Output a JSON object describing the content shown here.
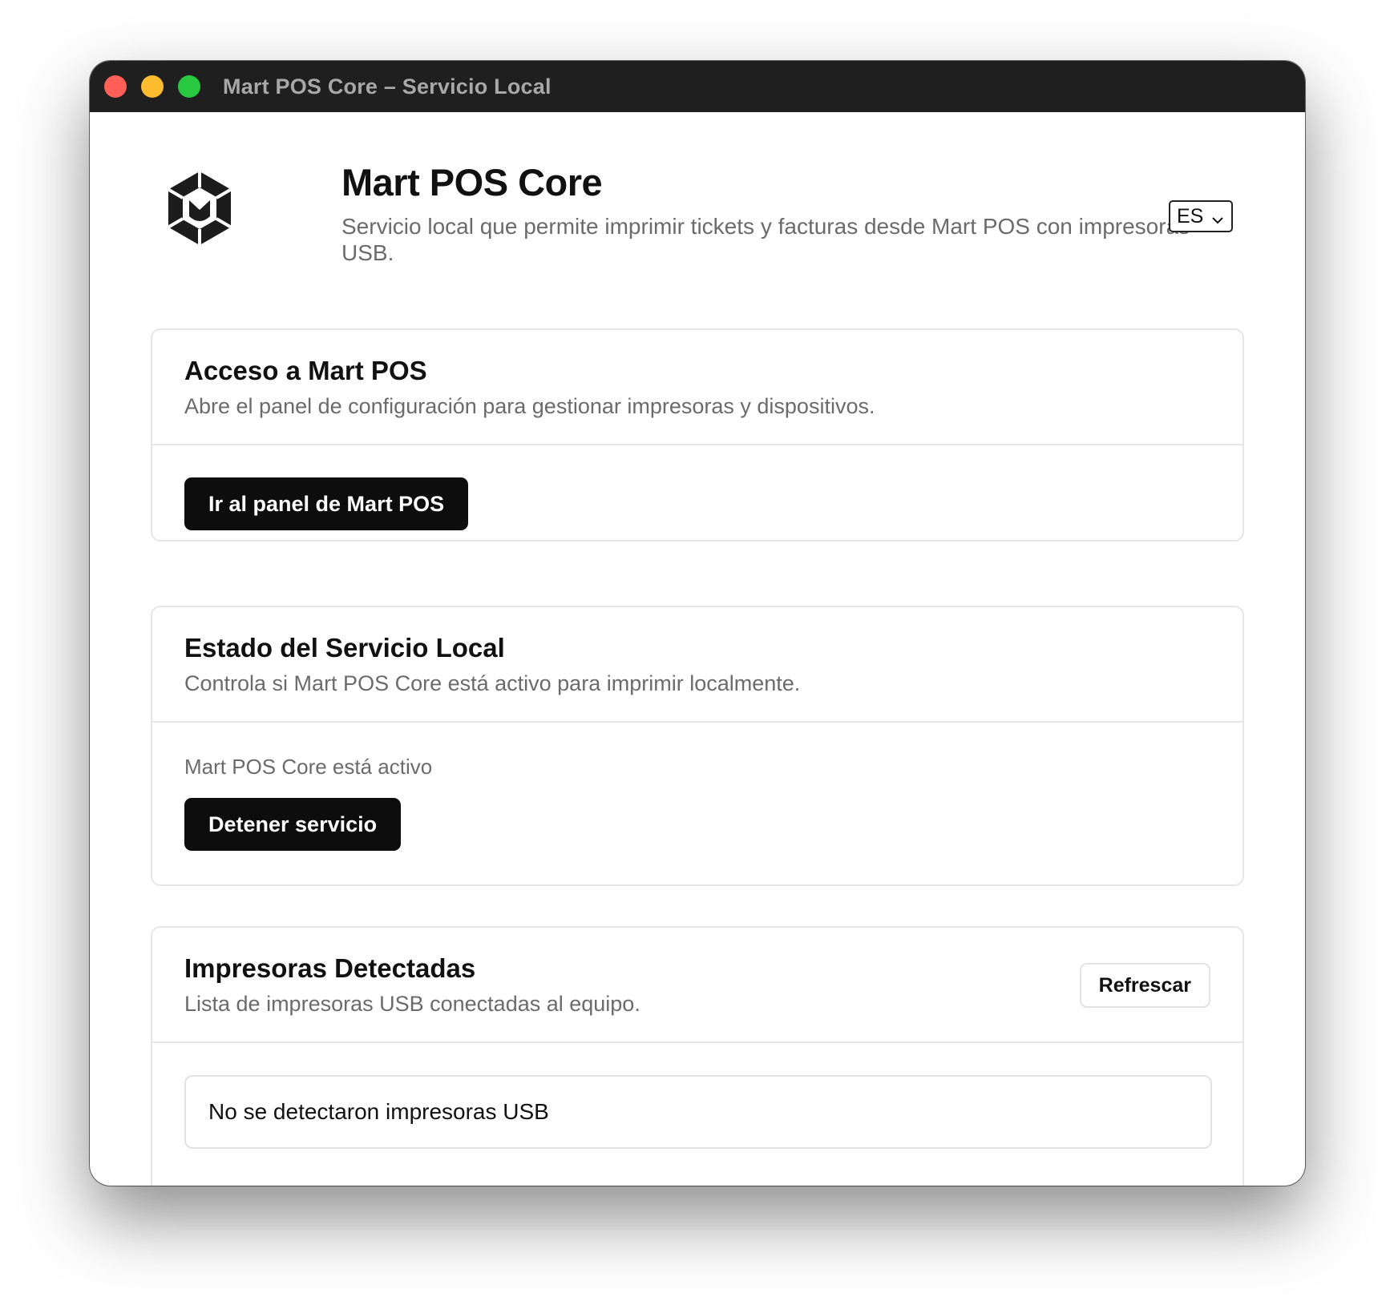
{
  "window": {
    "title": "Mart POS Core – Servicio Local"
  },
  "header": {
    "app_title": "Mart POS Core",
    "subtitle": "Servicio local que permite imprimir tickets y facturas desde Mart POS con impresoras USB.",
    "logo_icon": "hexagon-m-logo-icon",
    "language": {
      "selected": "ES",
      "icon": "chevron-down-icon"
    }
  },
  "access_card": {
    "title": "Acceso a Mart POS",
    "description": "Abre el panel de configuración para gestionar impresoras y dispositivos.",
    "button_label": "Ir al panel de Mart POS"
  },
  "service_card": {
    "title": "Estado del Servicio Local",
    "description": "Controla si Mart POS Core está activo para imprimir localmente.",
    "status_text": "Mart POS Core está activo",
    "button_label": "Detener servicio"
  },
  "printers_card": {
    "title": "Impresoras Detectadas",
    "description": "Lista de impresoras USB conectadas al equipo.",
    "refresh_label": "Refrescar",
    "empty_message": "No se detectaron impresoras USB"
  },
  "colors": {
    "titlebar": "#1f1f1f",
    "traffic_close": "#fe5f57",
    "traffic_minimize": "#febc2e",
    "traffic_maximize": "#28c840",
    "primary_button": "#0d0d0d",
    "muted_text": "#6b6b6b",
    "border": "#e6e6e6"
  }
}
